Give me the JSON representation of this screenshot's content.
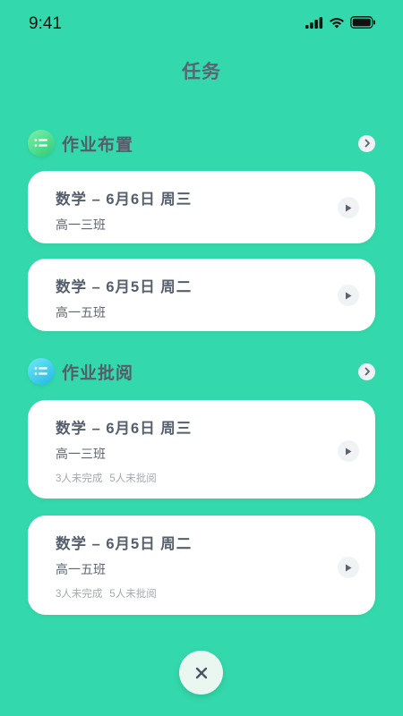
{
  "status_bar": {
    "time": "9:41"
  },
  "page": {
    "title": "任务"
  },
  "sections": [
    {
      "title": "作业布置",
      "icon": "list-icon",
      "accent": "#2DCB77",
      "cards": [
        {
          "title": "数学 – 6月6日 周三",
          "class_name": "高一三班"
        },
        {
          "title": "数学 – 6月5日 周二",
          "class_name": "高一五班"
        }
      ]
    },
    {
      "title": "作业批阅",
      "icon": "list-icon",
      "accent": "#22B7E3",
      "cards": [
        {
          "title": "数学 – 6月6日 周三",
          "class_name": "高一三班",
          "incomplete": "3人未完成",
          "unreviewed": "5人未批阅"
        },
        {
          "title": "数学 – 6月5日 周二",
          "class_name": "高一五班",
          "incomplete": "3人未完成",
          "unreviewed": "5人未批阅"
        }
      ]
    }
  ],
  "colors": {
    "background": "#33D9AC",
    "card": "#FFFFFF",
    "text": "#555E6C",
    "muted": "#A4A9B1"
  }
}
